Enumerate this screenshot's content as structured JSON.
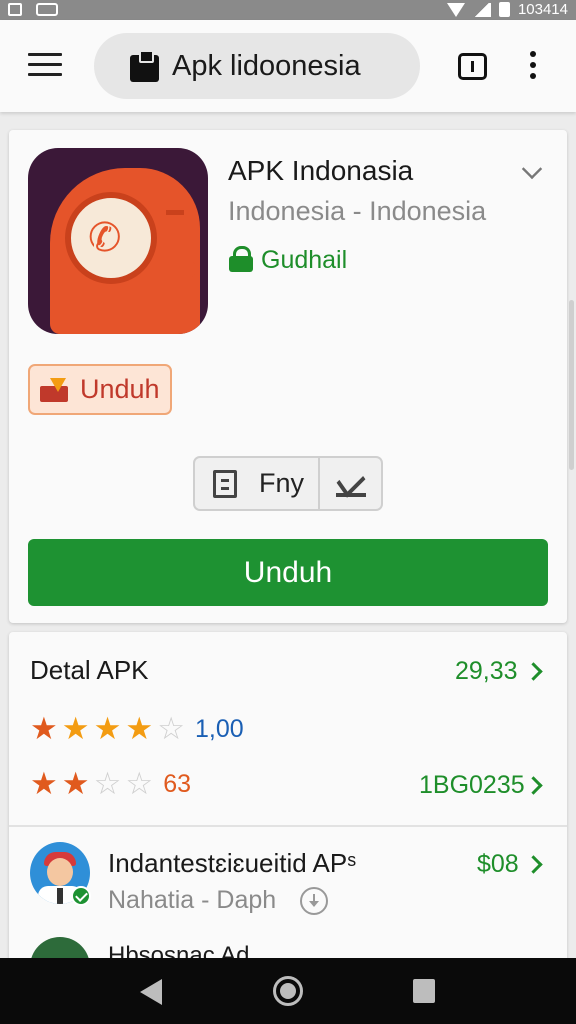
{
  "status_bar": {
    "time": "103414"
  },
  "app_bar": {
    "search_text": "Apk lidoonesia",
    "menu_icon": "hamburger-menu-icon",
    "tabs_icon": "tab-switcher-icon",
    "overflow_icon": "kebab-menu-icon"
  },
  "app_card": {
    "title": "APK Indonasia",
    "subtitle": "Indonesia - Indonesia",
    "verified_label": "Gudhail",
    "badge_label": "Unduh",
    "segment_left_label": "Fny",
    "download_button": "Unduh",
    "colors": {
      "accent_green": "#1e9232",
      "badge_orange": "#c0392b",
      "icon_bg": "#3b1838"
    }
  },
  "details": {
    "title": "Detal APK",
    "title_value": "29,33",
    "rating1": {
      "stars": 4,
      "value": "1,00",
      "color": "#1a5fb4"
    },
    "rating2": {
      "stars": 2,
      "value": "63",
      "right_value": "1BG0235",
      "color": "#e05a1e"
    },
    "item": {
      "title": "Indantestɛiɛueitid APˢ",
      "subtitle": "Nahatia - Daph",
      "value": "$08"
    },
    "peek_title": "Hbsosnac Ad"
  }
}
